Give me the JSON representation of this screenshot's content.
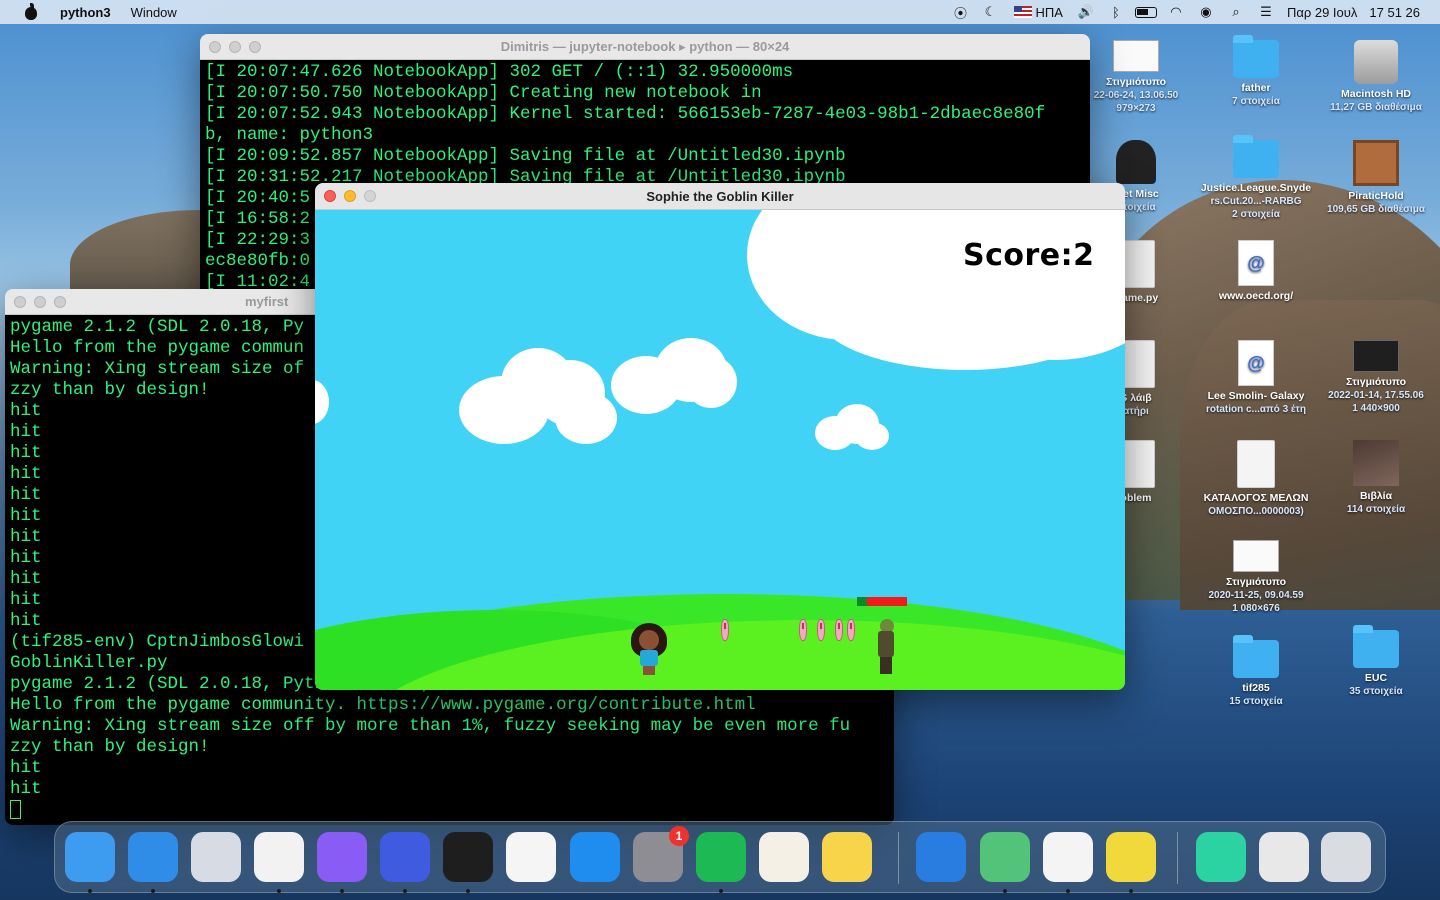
{
  "menubar": {
    "app_name": "python3",
    "menus": [
      "Window"
    ],
    "status": {
      "input_source": "ΗΠΑ",
      "date": "Παρ 29 Ιουλ",
      "time": "17 51 26"
    }
  },
  "terminal_back": {
    "title": "Dimitris — jupyter-notebook ▸ python — 80×24",
    "lines": [
      "[I 20:07:47.626 NotebookApp] 302 GET / (::1) 32.950000ms",
      "[I 20:07:50.750 NotebookApp] Creating new notebook in",
      "[I 20:07:52.943 NotebookApp] Kernel started: 566153eb-7287-4e03-98b1-2dbaec8e80f",
      "b, name: python3",
      "[I 20:09:52.857 NotebookApp] Saving file at /Untitled30.ipynb",
      "[I 20:31:52.217 NotebookApp] Saving file at /Untitled30.ipynb",
      "[I 20:40:5",
      "[I 16:58:2",
      "[I 22:29:3",
      "ec8e80fb:0",
      "[I 11:02:4"
    ]
  },
  "terminal_front": {
    "title": "myfirst",
    "lines": [
      "pygame 2.1.2 (SDL 2.0.18, Py",
      "Hello from the pygame commun",
      "Warning: Xing stream size of",
      "zzy than by design!",
      "hit",
      "hit",
      "hit",
      "hit",
      "hit",
      "hit",
      "hit",
      "hit",
      "hit",
      "hit",
      "hit",
      "(tif285-env) CptnJimbosGlowi",
      "GoblinKiller.py",
      "pygame 2.1.2 (SDL 2.0.18, Python 3.7.10)",
      "Hello from the pygame community. https://www.pygame.org/contribute.html",
      "Warning: Xing stream size off by more than 1%, fuzzy seeking may be even more fu",
      "zzy than by design!",
      "hit",
      "hit"
    ]
  },
  "game": {
    "title": "Sophie the Goblin Killer",
    "score_label": "Score:2",
    "sky_color": "#41d3f6",
    "goblin_health_fraction": 0.2,
    "projectile_count": 5
  },
  "desktop_icons": [
    {
      "label": "Στιγμιότυπο",
      "sub1": "22-06-24, 13.06.50",
      "sub2": "979×273",
      "icon": "screenshot-icon"
    },
    {
      "label": "father",
      "sub1": "7 στοιχεία",
      "sub2": "",
      "icon": "folder-icon"
    },
    {
      "label": "Macintosh HD",
      "sub1": "11,27 GB διαθέσιμα",
      "sub2": "",
      "icon": "disk-icon"
    },
    {
      "label": "cret Misc",
      "sub1": "στοιχεία",
      "sub2": "",
      "icon": "spy-icon"
    },
    {
      "label": "Justice.League.Snyde",
      "sub1": "rs.Cut.20...-RARBG",
      "sub2": "2 στοιχεία",
      "icon": "folder-icon"
    },
    {
      "label": "PiraticHold",
      "sub1": "109,65 GB διαθέσιμα",
      "sub2": "",
      "icon": "crate-icon"
    },
    {
      "label": "Game.py",
      "sub1": "",
      "sub2": "",
      "icon": "python-file-icon"
    },
    {
      "label": "www.oecd.org/",
      "sub1": "",
      "sub2": "",
      "icon": "http-icon"
    },
    {
      "label": "S λάιβ",
      "sub1": "ατήρι",
      "sub2": "",
      "icon": "safari-doc-icon"
    },
    {
      "label": "Lee Smolin- Galaxy",
      "sub1": "rotation c...από 3 έτη",
      "sub2": "",
      "icon": "http-icon"
    },
    {
      "label": "Στιγμιότυπο",
      "sub1": "2022-01-14, 17.55.06",
      "sub2": "1 440×900",
      "icon": "screenshot-icon"
    },
    {
      "label": "oblem",
      "sub1": "",
      "sub2": "",
      "icon": "document-icon"
    },
    {
      "label": "ΚΑΤΑΛΟΓΟΣ ΜΕΛΩΝ",
      "sub1": "ΟΜΟΣΠΟ...0000003)",
      "sub2": "",
      "icon": "document-icon"
    },
    {
      "label": "Βιβλία",
      "sub1": "114 στοιχεία",
      "sub2": "",
      "icon": "photo-folder-icon"
    },
    {
      "label": "Στιγμιότυπο",
      "sub1": "2020-11-25, 09.04.59",
      "sub2": "1 080×676",
      "icon": "screenshot-icon"
    },
    {
      "label": "tif285",
      "sub1": "15 στοιχεία",
      "sub2": "",
      "icon": "folder-icon"
    },
    {
      "label": "EUC",
      "sub1": "35 στοιχεία",
      "sub2": "",
      "icon": "folder-icon"
    }
  ],
  "dock": {
    "apps": [
      {
        "name": "finder-icon",
        "color": "#3d9cf0",
        "running": true
      },
      {
        "name": "safari-icon",
        "color": "#2f8de8",
        "running": true
      },
      {
        "name": "launchpad-icon",
        "color": "#d7dce4",
        "running": false
      },
      {
        "name": "chrome-icon",
        "color": "#f2f2f2",
        "running": true
      },
      {
        "name": "messenger-icon",
        "color": "#8a5cf6",
        "running": true
      },
      {
        "name": "pencil-app-icon",
        "color": "#3f5be0",
        "running": true
      },
      {
        "name": "terminal-icon",
        "color": "#1e1e1e",
        "running": true
      },
      {
        "name": "photos-icon",
        "color": "#f5f5f5",
        "running": false
      },
      {
        "name": "app-store-icon",
        "color": "#1f8cf0",
        "running": false
      },
      {
        "name": "system-preferences-icon",
        "color": "#8d8d93",
        "running": false,
        "badge": "1"
      },
      {
        "name": "spotify-icon",
        "color": "#1db954",
        "running": true
      },
      {
        "name": "popcorn-time-icon",
        "color": "#f5f0e6",
        "running": false
      },
      {
        "name": "notes-icon",
        "color": "#f7d44a",
        "running": false
      },
      {
        "name": "teamviewer-icon",
        "color": "#2a7de0",
        "running": false
      },
      {
        "name": "atom-icon",
        "color": "#53c37a",
        "running": true
      },
      {
        "name": "textedit-icon",
        "color": "#f4f4f4",
        "running": true
      },
      {
        "name": "python-launcher-icon",
        "color": "#f1d93b",
        "running": true
      },
      {
        "name": "screenshot-stack-icon",
        "color": "#2bd3a3",
        "running": false
      },
      {
        "name": "downloads-stack-icon",
        "color": "#e8e8e8",
        "running": false
      },
      {
        "name": "trash-icon",
        "color": "#d9dde2",
        "running": false
      }
    ]
  }
}
